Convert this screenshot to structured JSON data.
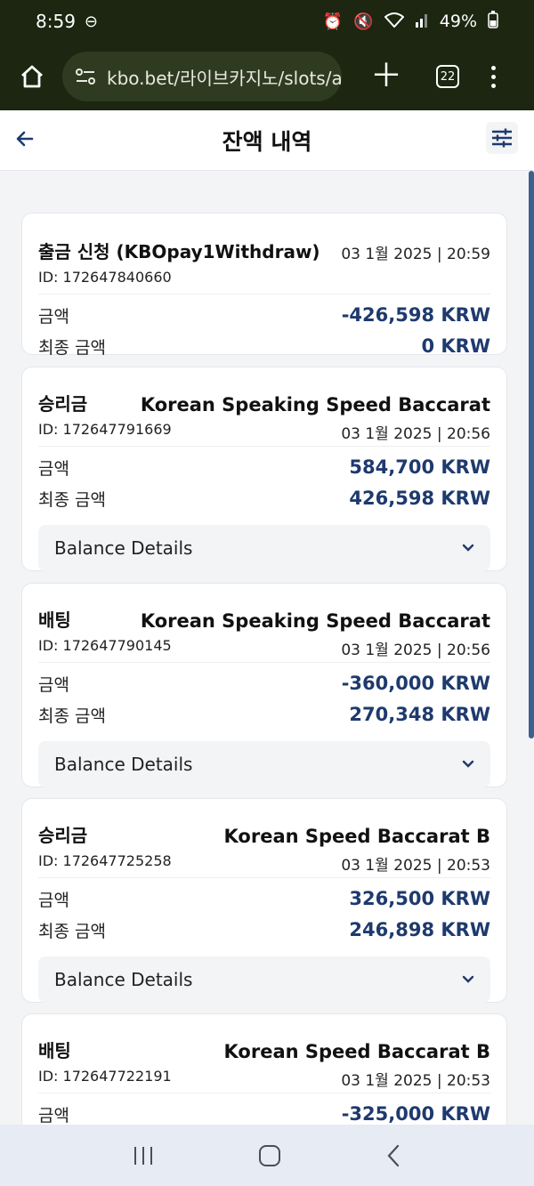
{
  "status": {
    "time": "8:59",
    "battery": "49%"
  },
  "browser": {
    "url": "kbo.bet/라이브카지노/slots/a",
    "tab_count": "22"
  },
  "header": {
    "title": "잔액 내역"
  },
  "labels": {
    "amount": "금액",
    "final_amount": "최종 금액",
    "balance_details": "Balance Details"
  },
  "cards": [
    {
      "title": "출금 신청 (KBOpay1Withdraw)",
      "game": "",
      "id": "ID: 172647840660",
      "date": "03 1월 2025 | 20:59",
      "amount": "-426,598 KRW",
      "final": "0 KRW",
      "has_details": false
    },
    {
      "title": "승리금",
      "game": "Korean Speaking Speed Baccarat",
      "id": "ID: 172647791669",
      "date": "03 1월 2025 | 20:56",
      "amount": "584,700 KRW",
      "final": "426,598 KRW",
      "has_details": true
    },
    {
      "title": "배팅",
      "game": "Korean Speaking Speed Baccarat",
      "id": "ID: 172647790145",
      "date": "03 1월 2025 | 20:56",
      "amount": "-360,000 KRW",
      "final": "270,348 KRW",
      "has_details": true
    },
    {
      "title": "승리금",
      "game": "Korean Speed Baccarat B",
      "id": "ID: 172647725258",
      "date": "03 1월 2025 | 20:53",
      "amount": "326,500 KRW",
      "final": "246,898 KRW",
      "has_details": true
    },
    {
      "title": "배팅",
      "game": "Korean Speed Baccarat B",
      "id": "ID: 172647722191",
      "date": "03 1월 2025 | 20:53",
      "amount": "-325,000 KRW",
      "final": "",
      "has_details": false
    }
  ]
}
